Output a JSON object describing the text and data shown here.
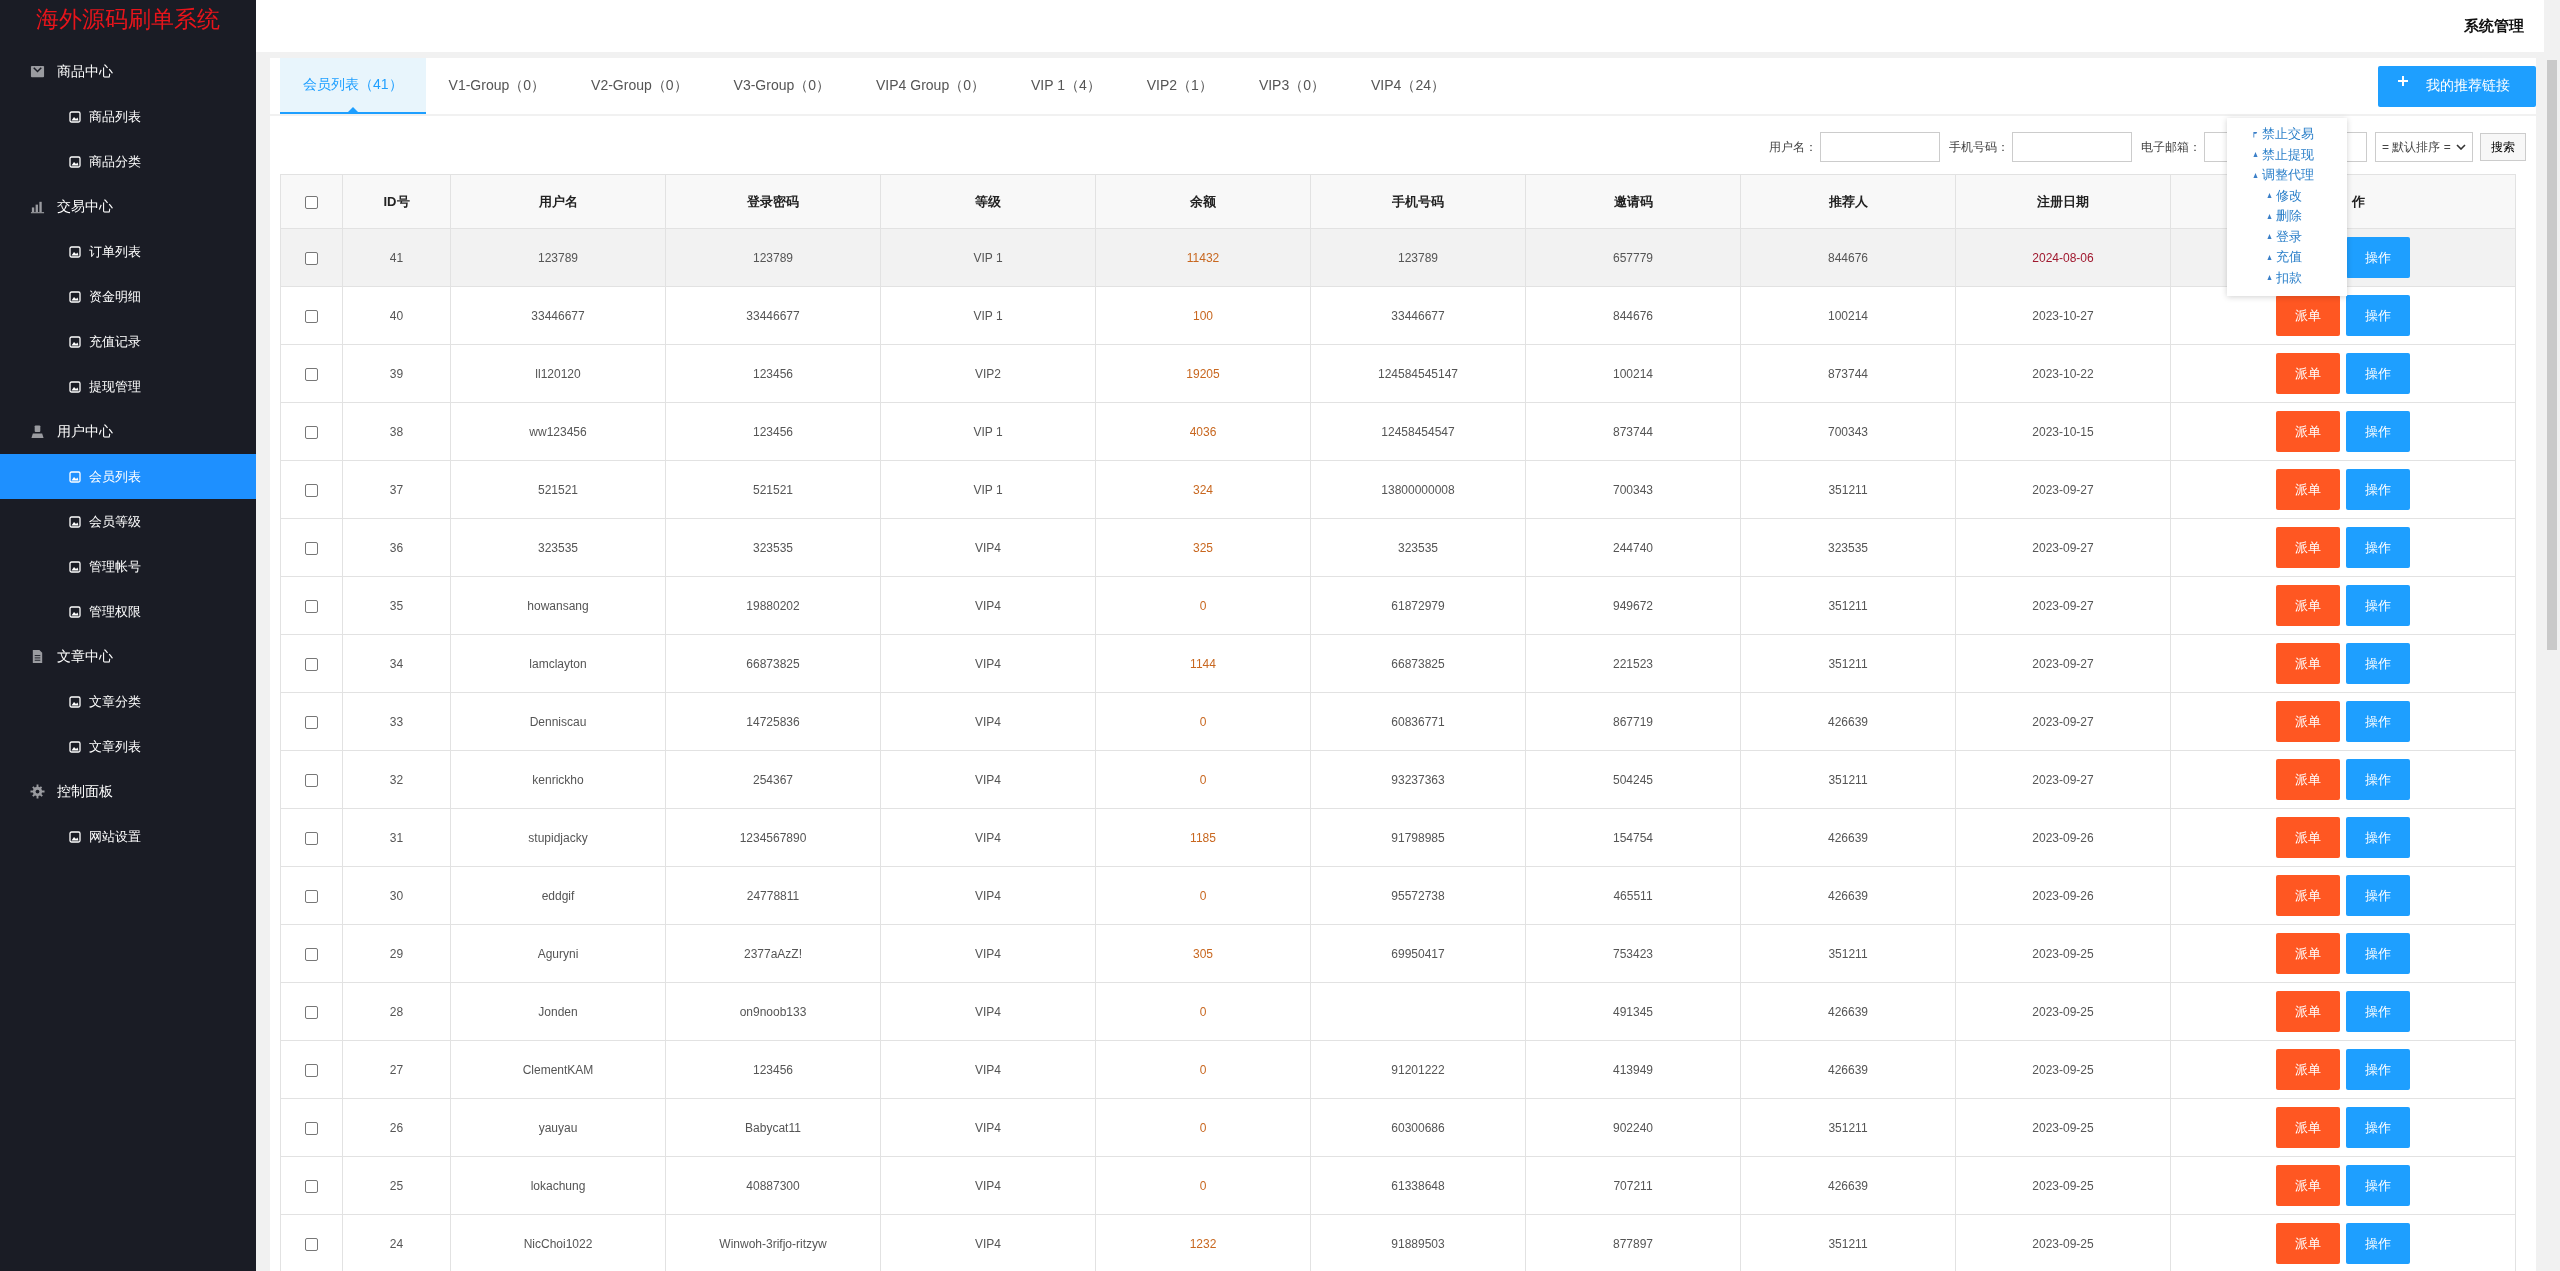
{
  "sidebar": {
    "title": "海外源码刷单系统",
    "groups": [
      {
        "label": "商品中心",
        "kind": "bag",
        "items": [
          {
            "label": "商品列表",
            "selected": false
          },
          {
            "label": "商品分类",
            "selected": false
          }
        ]
      },
      {
        "label": "交易中心",
        "kind": "chart",
        "items": [
          {
            "label": "订单列表",
            "selected": false
          },
          {
            "label": "资金明细",
            "selected": false
          },
          {
            "label": "充值记录",
            "selected": false
          },
          {
            "label": "提现管理",
            "selected": false
          }
        ]
      },
      {
        "label": "用户中心",
        "kind": "person",
        "items": [
          {
            "label": "会员列表",
            "selected": true
          },
          {
            "label": "会员等级",
            "selected": false
          },
          {
            "label": "管理帐号",
            "selected": false
          },
          {
            "label": "管理权限",
            "selected": false
          }
        ]
      },
      {
        "label": "文章中心",
        "kind": "document",
        "items": [
          {
            "label": "文章分类",
            "selected": false
          },
          {
            "label": "文章列表",
            "selected": false
          }
        ]
      },
      {
        "label": "控制面板",
        "kind": "gear",
        "items": [
          {
            "label": "网站设置",
            "selected": false
          }
        ]
      }
    ]
  },
  "header": {
    "title": "系统管理"
  },
  "tabs": [
    {
      "label": "会员列表（41）",
      "selected": true
    },
    {
      "label": "V1-Group（0）",
      "selected": false
    },
    {
      "label": "V2-Group（0）",
      "selected": false
    },
    {
      "label": "V3-Group（0）",
      "selected": false
    },
    {
      "label": "VIP4 Group（0）",
      "selected": false
    },
    {
      "label": "VIP 1（4）",
      "selected": false
    },
    {
      "label": "VIP2（1）",
      "selected": false
    },
    {
      "label": "VIP3（0）",
      "selected": false
    },
    {
      "label": "VIP4（24）",
      "selected": false
    }
  ],
  "link_button": {
    "label": "我的推荐链接"
  },
  "filters": {
    "fields": [
      {
        "label": "用户名："
      },
      {
        "label": "手机号码："
      },
      {
        "label": "电子邮箱："
      }
    ],
    "sort": {
      "value": "= 默认排序 ="
    },
    "search_button": "搜索"
  },
  "action_menu": {
    "items": [
      {
        "label": "禁止交易",
        "kind": "flag"
      },
      {
        "label": "禁止提现",
        "kind": "triangle"
      },
      {
        "label": "调整代理",
        "kind": "triangle",
        "children": [
          {
            "label": "修改",
            "kind": "triangle"
          },
          {
            "label": "删除",
            "kind": "triangle"
          },
          {
            "label": "登录",
            "kind": "triangle"
          },
          {
            "label": "充值",
            "kind": "triangle"
          },
          {
            "label": "扣款",
            "kind": "triangle"
          }
        ]
      }
    ]
  },
  "table": {
    "header_checked": false,
    "columns": [
      "ID号",
      "用户名",
      "登录密码",
      "等级",
      "余额",
      "手机号码",
      "邀请码",
      "推荐人",
      "注册日期",
      "作"
    ],
    "rows": [
      {
        "checked": false,
        "hovered": true,
        "id": "41",
        "username": "123789",
        "password": "123789",
        "level": "VIP 1",
        "balance": "11432",
        "phone": "123789",
        "invite": "657779",
        "referrer": "844676",
        "date": "2024-08-06",
        "date_flagged": true,
        "operate": "操作"
      },
      {
        "checked": false,
        "hovered": false,
        "id": "40",
        "username": "33446677",
        "password": "33446677",
        "level": "VIP 1",
        "balance": "100",
        "phone": "33446677",
        "invite": "844676",
        "referrer": "100214",
        "date": "2023-10-27",
        "date_flagged": false,
        "dispatch": "派单",
        "operate": "操作"
      },
      {
        "checked": false,
        "hovered": false,
        "id": "39",
        "username": "ll120120",
        "password": "123456",
        "level": "VIP2",
        "balance": "19205",
        "phone": "124584545147",
        "invite": "100214",
        "referrer": "873744",
        "date": "2023-10-22",
        "date_flagged": false,
        "dispatch": "派单",
        "operate": "操作"
      },
      {
        "checked": false,
        "hovered": false,
        "id": "38",
        "username": "ww123456",
        "password": "123456",
        "level": "VIP 1",
        "balance": "4036",
        "phone": "12458454547",
        "invite": "873744",
        "referrer": "700343",
        "date": "2023-10-15",
        "date_flagged": false,
        "dispatch": "派单",
        "operate": "操作"
      },
      {
        "checked": false,
        "hovered": false,
        "id": "37",
        "username": "521521",
        "password": "521521",
        "level": "VIP 1",
        "balance": "324",
        "phone": "13800000008",
        "invite": "700343",
        "referrer": "351211",
        "date": "2023-09-27",
        "date_flagged": false,
        "dispatch": "派单",
        "operate": "操作"
      },
      {
        "checked": false,
        "hovered": false,
        "id": "36",
        "username": "323535",
        "password": "323535",
        "level": "VIP4",
        "balance": "325",
        "phone": "323535",
        "invite": "244740",
        "referrer": "323535",
        "date": "2023-09-27",
        "date_flagged": false,
        "dispatch": "派单",
        "operate": "操作"
      },
      {
        "checked": false,
        "hovered": false,
        "id": "35",
        "username": "howansang",
        "password": "19880202",
        "level": "VIP4",
        "balance": "0",
        "phone": "61872979",
        "invite": "949672",
        "referrer": "351211",
        "date": "2023-09-27",
        "date_flagged": false,
        "dispatch": "派单",
        "operate": "操作"
      },
      {
        "checked": false,
        "hovered": false,
        "id": "34",
        "username": "lamclayton",
        "password": "66873825",
        "level": "VIP4",
        "balance": "1144",
        "phone": "66873825",
        "invite": "221523",
        "referrer": "351211",
        "date": "2023-09-27",
        "date_flagged": false,
        "dispatch": "派单",
        "operate": "操作"
      },
      {
        "checked": false,
        "hovered": false,
        "id": "33",
        "username": "Denniscau",
        "password": "14725836",
        "level": "VIP4",
        "balance": "0",
        "phone": "60836771",
        "invite": "867719",
        "referrer": "426639",
        "date": "2023-09-27",
        "date_flagged": false,
        "dispatch": "派单",
        "operate": "操作"
      },
      {
        "checked": false,
        "hovered": false,
        "id": "32",
        "username": "kenrickho",
        "password": "254367",
        "level": "VIP4",
        "balance": "0",
        "phone": "93237363",
        "invite": "504245",
        "referrer": "351211",
        "date": "2023-09-27",
        "date_flagged": false,
        "dispatch": "派单",
        "operate": "操作"
      },
      {
        "checked": false,
        "hovered": false,
        "id": "31",
        "username": "stupidjacky",
        "password": "1234567890",
        "level": "VIP4",
        "balance": "1185",
        "phone": "91798985",
        "invite": "154754",
        "referrer": "426639",
        "date": "2023-09-26",
        "date_flagged": false,
        "dispatch": "派单",
        "operate": "操作"
      },
      {
        "checked": false,
        "hovered": false,
        "id": "30",
        "username": "eddgif",
        "password": "24778811",
        "level": "VIP4",
        "balance": "0",
        "phone": "95572738",
        "invite": "465511",
        "referrer": "426639",
        "date": "2023-09-26",
        "date_flagged": false,
        "dispatch": "派单",
        "operate": "操作"
      },
      {
        "checked": false,
        "hovered": false,
        "id": "29",
        "username": "Aguryni",
        "password": "2377aAzZ!",
        "level": "VIP4",
        "balance": "305",
        "phone": "69950417",
        "invite": "753423",
        "referrer": "351211",
        "date": "2023-09-25",
        "date_flagged": false,
        "dispatch": "派单",
        "operate": "操作"
      },
      {
        "checked": false,
        "hovered": false,
        "id": "28",
        "username": "Jonden",
        "password": "on9noob133",
        "level": "VIP4",
        "balance": "0",
        "invite": "491345",
        "referrer": "426639",
        "date": "2023-09-25",
        "date_flagged": false,
        "dispatch": "派单",
        "operate": "操作"
      },
      {
        "checked": false,
        "hovered": false,
        "id": "27",
        "username": "ClementKAM",
        "password": "123456",
        "level": "VIP4",
        "balance": "0",
        "phone": "91201222",
        "invite": "413949",
        "referrer": "426639",
        "date": "2023-09-25",
        "date_flagged": false,
        "dispatch": "派单",
        "operate": "操作"
      },
      {
        "checked": false,
        "hovered": false,
        "id": "26",
        "username": "yauyau",
        "password": "Babycat11",
        "level": "VIP4",
        "balance": "0",
        "phone": "60300686",
        "invite": "902240",
        "referrer": "351211",
        "date": "2023-09-25",
        "date_flagged": false,
        "dispatch": "派单",
        "operate": "操作"
      },
      {
        "checked": false,
        "hovered": false,
        "id": "25",
        "username": "lokachung",
        "password": "40887300",
        "level": "VIP4",
        "balance": "0",
        "phone": "61338648",
        "invite": "707211",
        "referrer": "426639",
        "date": "2023-09-25",
        "date_flagged": false,
        "dispatch": "派单",
        "operate": "操作"
      },
      {
        "checked": false,
        "hovered": false,
        "id": "24",
        "username": "NicChoi1022",
        "password": "Winwoh-3rifjo-ritzyw",
        "level": "VIP4",
        "balance": "1232",
        "phone": "91889503",
        "invite": "877897",
        "referrer": "351211",
        "date": "2023-09-25",
        "date_flagged": false,
        "dispatch": "派单",
        "operate": "操作"
      }
    ]
  }
}
